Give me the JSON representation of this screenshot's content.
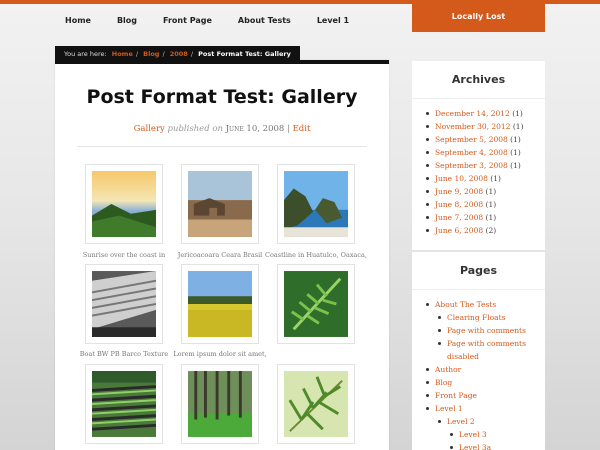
{
  "nav": {
    "items": [
      "Home",
      "Blog",
      "Front Page",
      "About Tests",
      "Level 1"
    ],
    "site_name": "Locally Lost"
  },
  "breadcrumb": {
    "label": "You are here:",
    "links": [
      "Home",
      "Blog",
      "2008"
    ],
    "current": "Post Format Test: Gallery"
  },
  "post": {
    "title": "Post Format Test: Gallery",
    "category": "Gallery",
    "published_text": "published on",
    "date": "June 10, 2008",
    "separator": "|",
    "edit": "Edit"
  },
  "gallery": {
    "captions": [
      "Sunrise over the coast in",
      "Jericoacoara Ceara Brasil",
      "Coastline in Huatulco, Oaxaca,",
      "Boat BW PB Barco Texture",
      "Lorem ipsum dolor sit amet,",
      "",
      "",
      "",
      ""
    ]
  },
  "archives": {
    "title": "Archives",
    "items": [
      {
        "label": "December 14, 2012",
        "count": "(1)"
      },
      {
        "label": "November 30, 2012",
        "count": "(1)"
      },
      {
        "label": "September 5, 2008",
        "count": "(1)"
      },
      {
        "label": "September 4, 2008",
        "count": "(1)"
      },
      {
        "label": "September 3, 2008",
        "count": "(1)"
      },
      {
        "label": "June 10, 2008",
        "count": "(1)"
      },
      {
        "label": "June 9, 2008",
        "count": "(1)"
      },
      {
        "label": "June 8, 2008",
        "count": "(1)"
      },
      {
        "label": "June 7, 2008",
        "count": "(1)"
      },
      {
        "label": "June 6, 2008",
        "count": "(2)"
      }
    ]
  },
  "pages": {
    "title": "Pages",
    "items": [
      {
        "label": "About The Tests",
        "level": 0
      },
      {
        "label": "Clearing Floats",
        "level": 1
      },
      {
        "label": "Page with comments",
        "level": 1
      },
      {
        "label": "Page with comments disabled",
        "level": 1
      },
      {
        "label": "Author",
        "level": 0
      },
      {
        "label": "Blog",
        "level": 0
      },
      {
        "label": "Front Page",
        "level": 0
      },
      {
        "label": "Level 1",
        "level": 0
      },
      {
        "label": "Level 2",
        "level": 1
      },
      {
        "label": "Level 3",
        "level": 2
      },
      {
        "label": "Level 3a",
        "level": 2
      }
    ]
  },
  "colors": {
    "accent": "#d35a1b",
    "dark": "#111111"
  }
}
